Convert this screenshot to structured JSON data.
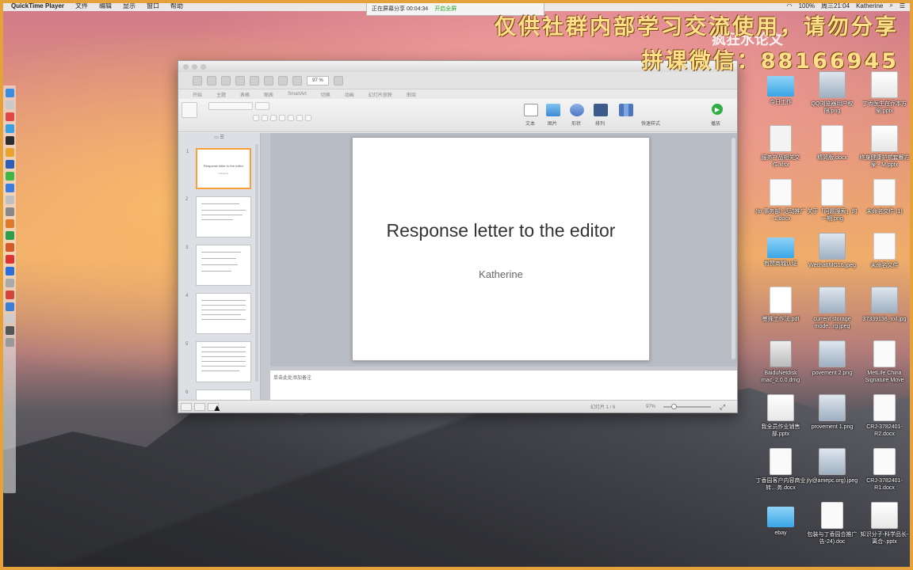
{
  "menubar": {
    "app_name": "QuickTime Player",
    "menus": [
      "文件",
      "编辑",
      "显示",
      "窗口",
      "帮助"
    ],
    "clock": "周三21:04",
    "user": "Katherine",
    "battery": "100%"
  },
  "recording": {
    "status": "正在屏幕分享 00:04:34",
    "note": "开启全屏"
  },
  "watermark": {
    "line1": "仅供社群内部学习交流使用，请勿分享",
    "line2": "拼课微信：88166945",
    "sub": "疯狂水论文"
  },
  "ppt": {
    "zoom_field": "97 %",
    "ribbon_tabs": [
      "开始",
      "主题",
      "表格",
      "图表",
      "SmartArt",
      "切换",
      "动画",
      "幻灯片放映",
      "审阅"
    ],
    "ribbon_labels": [
      "文本",
      "图片",
      "形状",
      "排列",
      "快速样式",
      "播放"
    ],
    "slide_title": "Response letter to the editor",
    "slide_subtitle": "Katherine",
    "thumb_title": "Response letter to the editor",
    "thumb_subtitle": "Katherine",
    "thumb_numbers": [
      "1",
      "2",
      "3",
      "4",
      "5",
      "6"
    ],
    "notes_placeholder": "单击此处添加备注",
    "slide_count": "幻灯片 1 / 6",
    "zoom_pct": "97%"
  },
  "desktop_icons": [
    {
      "name": "今日工作",
      "kind": "folder"
    },
    {
      "name": "QQ浏览器用户权限.png",
      "kind": "img"
    },
    {
      "name": "丁香医生在乔本方案.pptx",
      "kind": "pptx"
    },
    {
      "name": "服务产品相关文件.xlsx",
      "kind": "xlsx"
    },
    {
      "name": "精简版.docx",
      "kind": "doc"
    },
    {
      "name": "终身健康护航套餐方案 - M.pptx",
      "kind": "pptx"
    },
    {
      "name": "(to 事务部) 活动推广 - 1.docx",
      "kind": "doc"
    },
    {
      "name": "关于「问题搜索」的一期.png",
      "kind": "doc"
    },
    {
      "name": "未命名文件 (1)",
      "kind": "doc"
    },
    {
      "name": "有赞商城认证",
      "kind": "folder"
    },
    {
      "name": "WechatIMG16.jpeg",
      "kind": "img"
    },
    {
      "name": "未命名文件",
      "kind": "doc"
    },
    {
      "name": "曼殊工作法.pdf",
      "kind": "pdf"
    },
    {
      "name": "current storage mode...rg.jpeg",
      "kind": "img"
    },
    {
      "name": "37339136_xxl.jpg",
      "kind": "img"
    },
    {
      "name": "BaiduNetdisk mac_2.0.0.dmg",
      "kind": "dmg"
    },
    {
      "name": "povement 2.png",
      "kind": "img"
    },
    {
      "name": "MetLife China Signature Move",
      "kind": "doc"
    },
    {
      "name": "我全员作业销售部.pptx",
      "kind": "pptx"
    },
    {
      "name": "provement 1.png",
      "kind": "img"
    },
    {
      "name": "CRJ-3782401-R2.docx",
      "kind": "doc"
    },
    {
      "name": "丁香园客户内容商业转…务.docx",
      "kind": "doc"
    },
    {
      "name": "jly@amepc.org).jpeg",
      "kind": "img"
    },
    {
      "name": "CRJ-3782401-R1.docx",
      "kind": "doc"
    },
    {
      "name": "ebay",
      "kind": "folder"
    },
    {
      "name": "包装与丁香园合推广告-24).doc",
      "kind": "doc"
    },
    {
      "name": "知识分子-科学品长-离合-.pptx",
      "kind": "pptx"
    }
  ],
  "colors": {
    "accent_orange": "#f5a03a",
    "play_green": "#2fae46",
    "watermark_yellow": "#ffe08a"
  }
}
